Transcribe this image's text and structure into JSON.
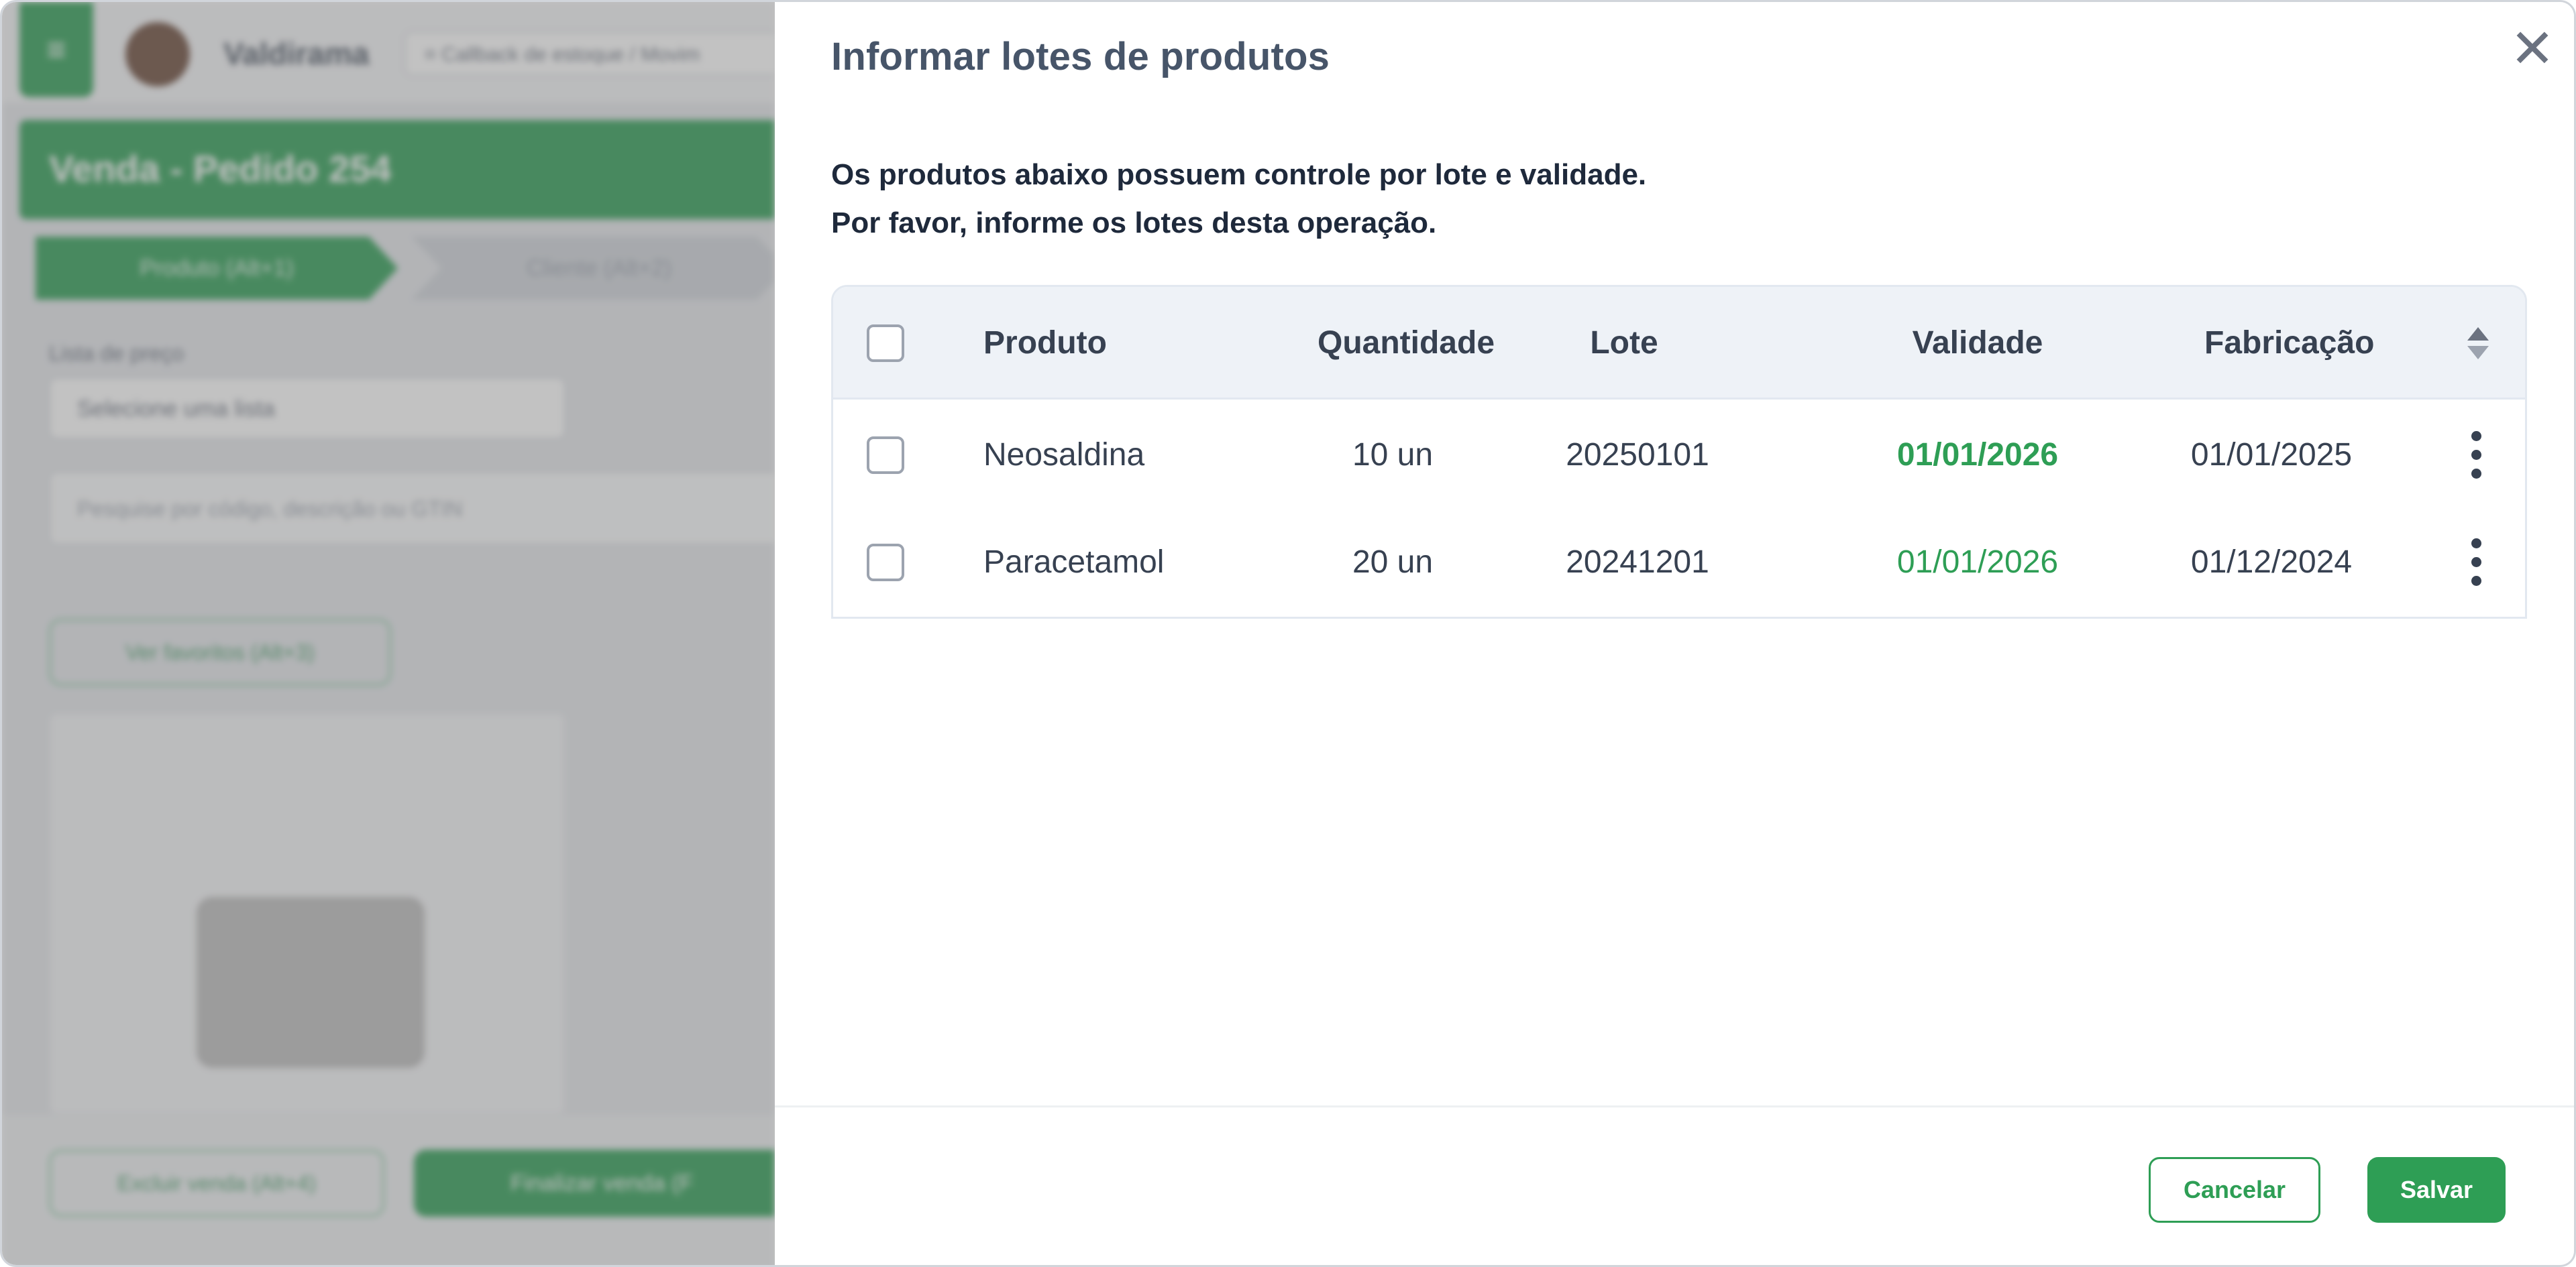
{
  "background": {
    "menu_icon": "hamburger-icon",
    "brand": "Valdirama",
    "breadcrumb": "Callback de estoque / Movim",
    "page_title": "Venda - Pedido 254",
    "steps": [
      "Produto (Alt+1)",
      "Cliente (Alt+2)"
    ],
    "price_list_label": "Lista de preço",
    "price_list_placeholder": "Selecione uma lista",
    "search_placeholder": "Pesquise por código, descrição ou GTIN",
    "see_favorites": "Ver favoritos (Alt+3)",
    "cancel_sale": "Excluir venda (Alt+4)",
    "finish_sale": "Finalizar venda (F"
  },
  "modal": {
    "title": "Informar lotes de produtos",
    "intro_line1": "Os produtos abaixo possuem controle por lote e validade.",
    "intro_line2": "Por favor, informe os lotes desta operação.",
    "close_icon": "close-icon",
    "table": {
      "headers": {
        "produto": "Produto",
        "quantidade": "Quantidade",
        "lote": "Lote",
        "validade": "Validade",
        "fabricacao": "Fabricação"
      },
      "rows": [
        {
          "produto": "Neosaldina",
          "quantidade": "10 un",
          "lote": "20250101",
          "validade": "01/01/2026",
          "fabricacao": "01/01/2025"
        },
        {
          "produto": "Paracetamol",
          "quantidade": "20 un",
          "lote": "20241201",
          "validade": "01/01/2026",
          "fabricacao": "01/12/2024"
        }
      ]
    },
    "buttons": {
      "cancel": "Cancelar",
      "save": "Salvar"
    }
  },
  "colors": {
    "accent": "#2e9e55",
    "title": "#475569",
    "header_bg": "#eef2f7"
  }
}
